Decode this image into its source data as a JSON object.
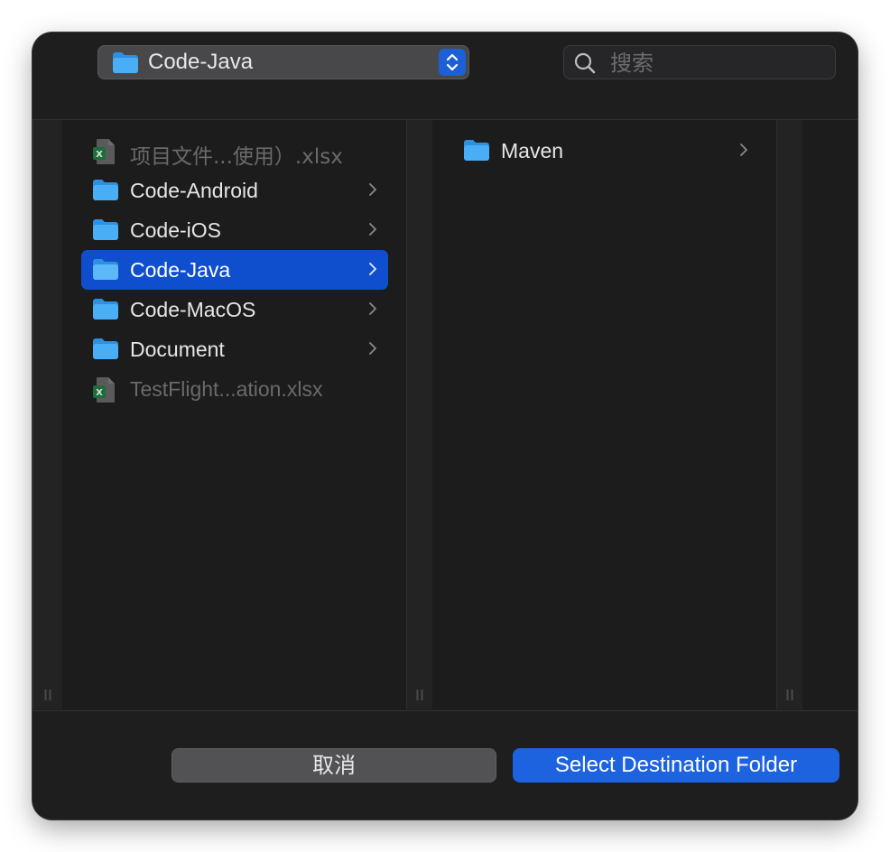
{
  "header": {
    "path_label": "Code-Java",
    "search_placeholder": "搜索"
  },
  "browser": {
    "column1": [
      {
        "label": "项目文件...使用）.xlsx",
        "kind": "excel-file",
        "enabled": false
      },
      {
        "label": "Code-Android",
        "kind": "folder",
        "enabled": true,
        "has_children": true
      },
      {
        "label": "Code-iOS",
        "kind": "folder",
        "enabled": true,
        "has_children": true
      },
      {
        "label": "Code-Java",
        "kind": "folder",
        "enabled": true,
        "has_children": true,
        "selected": true
      },
      {
        "label": "Code-MacOS",
        "kind": "folder",
        "enabled": true,
        "has_children": true
      },
      {
        "label": "Document",
        "kind": "folder",
        "enabled": true,
        "has_children": true
      },
      {
        "label": "TestFlight...ation.xlsx",
        "kind": "excel-file",
        "enabled": false
      }
    ],
    "column2": [
      {
        "label": "Maven",
        "kind": "folder",
        "enabled": true,
        "has_children": true
      }
    ]
  },
  "footer": {
    "cancel_label": "取消",
    "confirm_label": "Select Destination Folder"
  },
  "colors": {
    "accent": "#0f4fce",
    "primary_button": "#1d63e0",
    "folder": "#3aa0f2",
    "background": "#1c1c1d"
  }
}
